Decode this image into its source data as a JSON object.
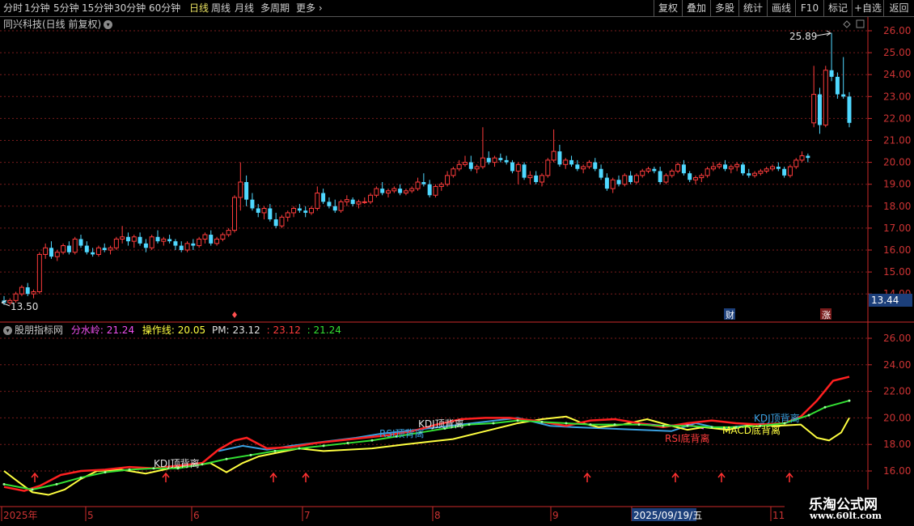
{
  "toolbar": {
    "periods": [
      "分时",
      "1分钟",
      "5分钟",
      "15分钟",
      "30分钟",
      "60分钟",
      "日线",
      "周线",
      "月线",
      "多周期",
      "更多"
    ],
    "active_period": "日线",
    "tools": [
      "复权",
      "叠加",
      "多股",
      "统计",
      "画线",
      "F10",
      "标记",
      "+自选",
      "返回"
    ]
  },
  "main_title": "同兴科技(日线 前复权)",
  "indicator": {
    "name": "股朋指标网",
    "fsl_label": "分水岭:",
    "fsl_value": "21.24",
    "czx_label": "操作线:",
    "czx_value": "20.05",
    "pm_label": "PM:",
    "pm_value": "23.12",
    "v2": ": 23.12",
    "v3": ": 21.24"
  },
  "price_axis": {
    "ticks": [
      "26.00",
      "25.00",
      "24.00",
      "23.00",
      "22.00",
      "21.00",
      "20.00",
      "19.00",
      "18.00",
      "17.00",
      "16.00",
      "15.00",
      "14.00"
    ],
    "current_price": "13.44"
  },
  "indicator_axis": {
    "ticks": [
      "26.00",
      "24.00",
      "22.00",
      "20.00",
      "18.00",
      "16.00"
    ]
  },
  "annotations": {
    "high_label": "25.89",
    "low_label": "13.50",
    "cai_badge": "财",
    "zhang_badge": "涨",
    "signals": [
      "KDJ顶背离",
      "KDJ顶背离",
      "RSI顶背离",
      "RSI底背离",
      "MACD底背离",
      "KDJ顶背离"
    ]
  },
  "date_axis": {
    "labels": [
      "2025年",
      "5",
      "6",
      "7",
      "8",
      "9",
      "2025/09/19/五",
      "11"
    ]
  },
  "watermark": {
    "line1": "乐淘公式网",
    "line2": "www.60lt.com"
  },
  "colors": {
    "up": "#ff3c3c",
    "down": "#4fd8ff",
    "grid": "#7a1c1c",
    "fsl": "#f050f0",
    "czx": "#ffff40",
    "green_line": "#33e033",
    "arrow": "#ff3030"
  },
  "chart_data": {
    "type": "candlestick",
    "title": "同兴科技(日线 前复权)",
    "ylim": [
      13.4,
      26.5
    ],
    "x_labels": [
      "2025年",
      "5",
      "6",
      "7",
      "8",
      "9",
      "2025/09/19/五",
      "11"
    ],
    "candles": [
      [
        13.7,
        13.9,
        13.5,
        13.6
      ],
      [
        13.6,
        13.8,
        13.5,
        13.7
      ],
      [
        13.7,
        14.1,
        13.6,
        14.0
      ],
      [
        14.0,
        14.4,
        13.9,
        14.3
      ],
      [
        14.3,
        14.5,
        13.9,
        14.0
      ],
      [
        14.0,
        14.2,
        13.8,
        14.1
      ],
      [
        14.1,
        15.9,
        14.0,
        15.8
      ],
      [
        15.8,
        16.3,
        15.6,
        16.1
      ],
      [
        16.1,
        16.4,
        15.6,
        15.7
      ],
      [
        15.7,
        16.0,
        15.5,
        15.9
      ],
      [
        15.9,
        16.3,
        15.8,
        16.2
      ],
      [
        16.2,
        16.4,
        15.8,
        15.9
      ],
      [
        15.9,
        16.6,
        15.8,
        16.5
      ],
      [
        16.5,
        16.7,
        16.1,
        16.2
      ],
      [
        16.2,
        16.4,
        15.8,
        15.9
      ],
      [
        15.9,
        16.1,
        15.7,
        15.8
      ],
      [
        15.8,
        16.2,
        15.7,
        16.1
      ],
      [
        16.1,
        16.3,
        15.9,
        16.0
      ],
      [
        16.0,
        16.2,
        15.8,
        16.1
      ],
      [
        16.1,
        16.6,
        16.0,
        16.5
      ],
      [
        16.5,
        17.1,
        16.3,
        16.6
      ],
      [
        16.6,
        16.8,
        16.2,
        16.4
      ],
      [
        16.4,
        16.7,
        16.1,
        16.6
      ],
      [
        16.6,
        16.8,
        16.2,
        16.3
      ],
      [
        16.3,
        16.5,
        15.9,
        16.1
      ],
      [
        16.1,
        16.7,
        16.0,
        16.6
      ],
      [
        16.6,
        16.9,
        16.3,
        16.4
      ],
      [
        16.4,
        16.6,
        16.2,
        16.5
      ],
      [
        16.5,
        16.7,
        16.3,
        16.4
      ],
      [
        16.4,
        16.5,
        16.0,
        16.2
      ],
      [
        16.2,
        16.4,
        15.9,
        16.0
      ],
      [
        16.0,
        16.4,
        15.9,
        16.3
      ],
      [
        16.3,
        16.5,
        16.0,
        16.2
      ],
      [
        16.2,
        16.6,
        16.1,
        16.5
      ],
      [
        16.5,
        16.8,
        16.3,
        16.7
      ],
      [
        16.7,
        16.9,
        16.2,
        16.3
      ],
      [
        16.3,
        16.6,
        16.2,
        16.5
      ],
      [
        16.5,
        16.8,
        16.4,
        16.7
      ],
      [
        16.7,
        17.0,
        16.6,
        16.9
      ],
      [
        16.9,
        18.5,
        16.8,
        18.4
      ],
      [
        18.4,
        20.0,
        17.8,
        19.1
      ],
      [
        19.1,
        19.4,
        18.0,
        18.3
      ],
      [
        18.3,
        18.6,
        17.8,
        17.9
      ],
      [
        17.9,
        18.1,
        17.5,
        17.7
      ],
      [
        17.7,
        18.0,
        17.4,
        17.9
      ],
      [
        17.9,
        18.1,
        17.3,
        17.4
      ],
      [
        17.4,
        17.7,
        17.0,
        17.1
      ],
      [
        17.1,
        17.6,
        17.0,
        17.5
      ],
      [
        17.5,
        17.8,
        17.3,
        17.7
      ],
      [
        17.7,
        18.0,
        17.5,
        17.9
      ],
      [
        17.9,
        18.1,
        17.7,
        17.8
      ],
      [
        17.8,
        18.0,
        17.5,
        17.7
      ],
      [
        17.7,
        18.0,
        17.6,
        17.9
      ],
      [
        17.9,
        18.9,
        17.8,
        18.6
      ],
      [
        18.6,
        18.8,
        18.1,
        18.2
      ],
      [
        18.2,
        18.4,
        17.9,
        18.0
      ],
      [
        18.0,
        18.3,
        17.7,
        17.8
      ],
      [
        17.8,
        18.3,
        17.7,
        18.2
      ],
      [
        18.2,
        18.5,
        18.0,
        18.3
      ],
      [
        18.3,
        18.4,
        18.0,
        18.1
      ],
      [
        18.1,
        18.3,
        17.9,
        18.2
      ],
      [
        18.2,
        18.4,
        18.1,
        18.2
      ],
      [
        18.2,
        18.6,
        18.1,
        18.5
      ],
      [
        18.5,
        18.9,
        18.4,
        18.8
      ],
      [
        18.8,
        19.1,
        18.5,
        18.6
      ],
      [
        18.6,
        18.8,
        18.4,
        18.7
      ],
      [
        18.7,
        18.9,
        18.6,
        18.8
      ],
      [
        18.8,
        19.0,
        18.5,
        18.6
      ],
      [
        18.6,
        18.8,
        18.5,
        18.7
      ],
      [
        18.7,
        18.9,
        18.6,
        18.8
      ],
      [
        18.8,
        19.3,
        18.7,
        19.1
      ],
      [
        19.1,
        19.5,
        18.9,
        19.0
      ],
      [
        19.0,
        19.2,
        18.4,
        18.5
      ],
      [
        18.5,
        19.0,
        18.4,
        18.9
      ],
      [
        18.9,
        19.1,
        18.7,
        19.0
      ],
      [
        19.0,
        19.6,
        18.9,
        19.4
      ],
      [
        19.4,
        19.8,
        19.3,
        19.7
      ],
      [
        19.7,
        20.1,
        19.6,
        19.9
      ],
      [
        19.9,
        20.3,
        19.8,
        20.0
      ],
      [
        20.0,
        20.3,
        19.6,
        19.7
      ],
      [
        19.7,
        19.9,
        19.5,
        19.8
      ],
      [
        19.8,
        21.6,
        19.7,
        20.2
      ],
      [
        20.2,
        20.5,
        19.9,
        20.0
      ],
      [
        20.0,
        20.3,
        19.8,
        20.2
      ],
      [
        20.2,
        20.4,
        20.0,
        20.1
      ],
      [
        20.1,
        20.3,
        19.9,
        20.0
      ],
      [
        20.0,
        20.1,
        19.5,
        19.6
      ],
      [
        19.6,
        20.0,
        19.0,
        19.9
      ],
      [
        19.9,
        20.0,
        19.2,
        19.3
      ],
      [
        19.3,
        19.6,
        19.0,
        19.4
      ],
      [
        19.4,
        19.6,
        19.0,
        19.1
      ],
      [
        19.1,
        19.5,
        18.9,
        19.4
      ],
      [
        19.4,
        20.2,
        19.3,
        20.1
      ],
      [
        20.1,
        21.5,
        20.0,
        20.5
      ],
      [
        20.5,
        20.8,
        19.8,
        19.9
      ],
      [
        19.9,
        20.2,
        19.7,
        20.1
      ],
      [
        20.1,
        20.3,
        19.8,
        19.9
      ],
      [
        19.9,
        20.1,
        19.6,
        19.7
      ],
      [
        19.7,
        19.9,
        19.5,
        19.8
      ],
      [
        19.8,
        20.1,
        19.7,
        20.0
      ],
      [
        20.0,
        20.2,
        19.6,
        19.7
      ],
      [
        19.7,
        19.9,
        19.2,
        19.3
      ],
      [
        19.3,
        19.5,
        18.7,
        18.8
      ],
      [
        18.8,
        19.3,
        18.6,
        19.2
      ],
      [
        19.2,
        19.4,
        18.9,
        19.0
      ],
      [
        19.0,
        19.5,
        18.9,
        19.4
      ],
      [
        19.4,
        19.6,
        19.0,
        19.1
      ],
      [
        19.1,
        19.5,
        19.0,
        19.4
      ],
      [
        19.4,
        19.7,
        19.3,
        19.6
      ],
      [
        19.6,
        19.8,
        19.5,
        19.7
      ],
      [
        19.7,
        19.8,
        19.5,
        19.6
      ],
      [
        19.6,
        19.8,
        19.0,
        19.1
      ],
      [
        19.1,
        19.5,
        19.0,
        19.4
      ],
      [
        19.4,
        19.7,
        19.3,
        19.6
      ],
      [
        19.6,
        20.0,
        19.5,
        19.9
      ],
      [
        19.9,
        20.1,
        19.4,
        19.5
      ],
      [
        19.5,
        19.6,
        19.1,
        19.2
      ],
      [
        19.2,
        19.4,
        19.0,
        19.3
      ],
      [
        19.3,
        19.5,
        19.1,
        19.4
      ],
      [
        19.4,
        19.8,
        19.3,
        19.7
      ],
      [
        19.7,
        20.0,
        19.6,
        19.8
      ],
      [
        19.8,
        20.0,
        19.7,
        19.9
      ],
      [
        19.9,
        20.1,
        19.6,
        19.7
      ],
      [
        19.7,
        19.9,
        19.5,
        19.8
      ],
      [
        19.8,
        20.0,
        19.6,
        19.9
      ],
      [
        19.9,
        20.0,
        19.4,
        19.5
      ],
      [
        19.5,
        19.7,
        19.3,
        19.4
      ],
      [
        19.4,
        19.6,
        19.3,
        19.5
      ],
      [
        19.5,
        19.7,
        19.4,
        19.6
      ],
      [
        19.6,
        19.8,
        19.5,
        19.7
      ],
      [
        19.7,
        19.9,
        19.6,
        19.8
      ],
      [
        19.8,
        20.0,
        19.6,
        19.7
      ],
      [
        19.7,
        19.8,
        19.3,
        19.4
      ],
      [
        19.4,
        19.9,
        19.3,
        19.8
      ],
      [
        19.8,
        20.2,
        19.7,
        20.1
      ],
      [
        20.1,
        20.5,
        20.0,
        20.3
      ],
      [
        20.3,
        20.4,
        20.0,
        20.2
      ],
      [
        21.8,
        24.4,
        21.6,
        23.1
      ],
      [
        23.1,
        23.4,
        21.3,
        21.7
      ],
      [
        21.7,
        24.4,
        21.6,
        24.2
      ],
      [
        24.2,
        25.9,
        23.7,
        23.9
      ],
      [
        23.9,
        24.1,
        22.9,
        23.1
      ],
      [
        23.1,
        24.8,
        22.9,
        23.0
      ],
      [
        23.0,
        23.2,
        21.6,
        21.8
      ]
    ]
  }
}
